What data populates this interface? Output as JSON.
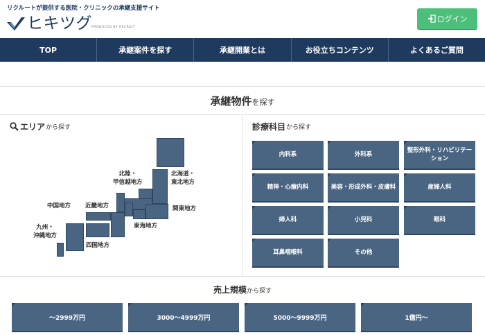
{
  "header": {
    "tagline": "リクルートが提供する医院・クリニックの承継支援サイト",
    "logo_text": "ヒキツグ",
    "logo_sub": "PRODUCED BY RECRUIT",
    "login_label": "ログイン"
  },
  "nav": {
    "items": [
      "TOP",
      "承継案件を探す",
      "承継開業とは",
      "お役立ちコンテンツ",
      "よくあるご質問"
    ]
  },
  "search_section": {
    "title_main": "承継物件",
    "title_suffix": "を探す"
  },
  "area": {
    "heading_main": "エリア",
    "heading_suffix": "から探す",
    "regions": {
      "hokkaido_tohoku": "北海道・\n東北地方",
      "hokuriku_koshinetsu": "北陸・\n甲信越地方",
      "kanto": "関東地方",
      "tokai": "東海地方",
      "kinki": "近畿地方",
      "chugoku": "中国地方",
      "shikoku": "四国地方",
      "kyushu_okinawa": "九州・\n沖縄地方"
    }
  },
  "specialty": {
    "heading_main": "診療科目",
    "heading_suffix": "から探す",
    "items": [
      "内科系",
      "外科系",
      "整形外科・リハビリテーション",
      "精神・心療内科",
      "美容・形成外科・皮膚科",
      "産婦人科",
      "婦人科",
      "小児科",
      "眼科",
      "耳鼻咽喉科",
      "その他"
    ]
  },
  "sales": {
    "heading_main": "売上規模",
    "heading_suffix": "から探す",
    "items": [
      "〜2999万円",
      "3000〜4999万円",
      "5000〜9999万円",
      "1億円〜"
    ]
  },
  "colors": {
    "navy": "#1e3a5f",
    "button_blue": "#4a6582",
    "login_green": "#4cbf7a"
  }
}
